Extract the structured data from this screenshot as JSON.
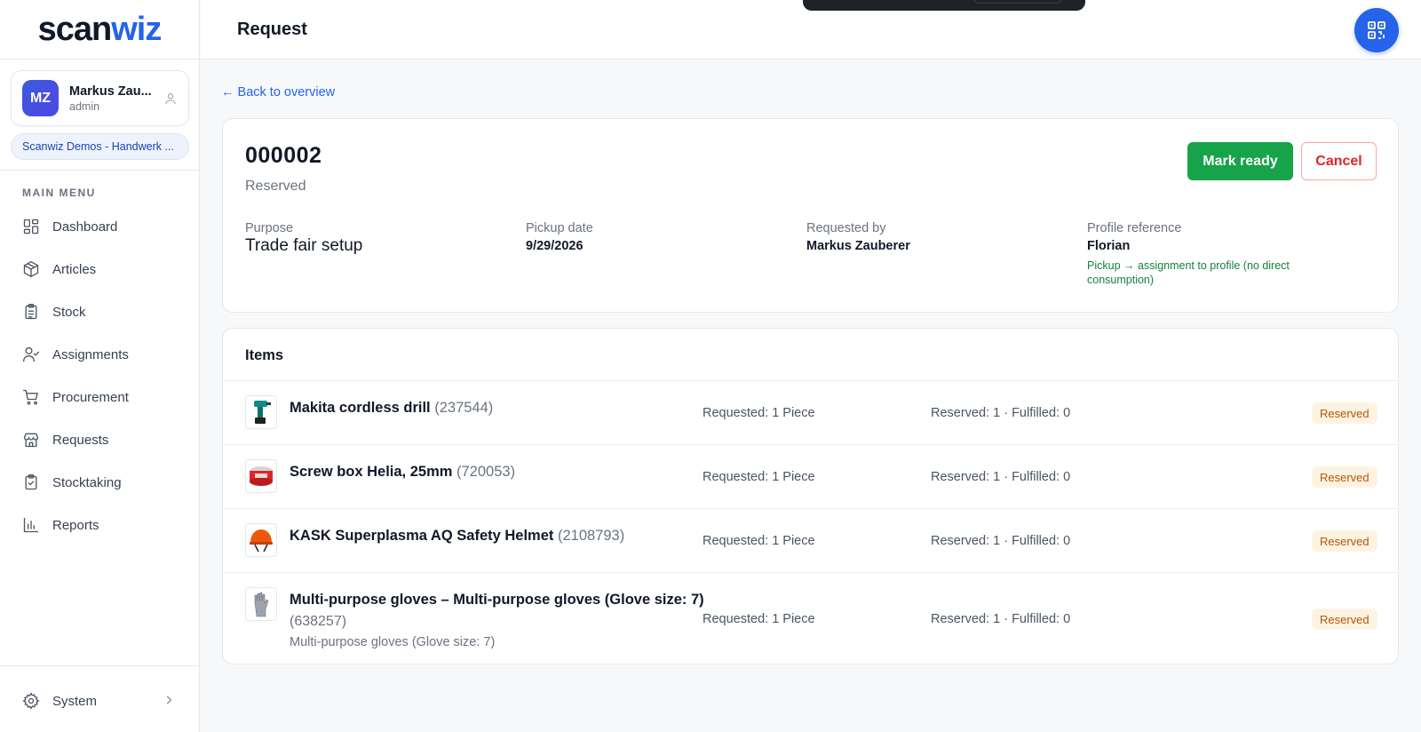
{
  "app": {
    "logo_part1": "scan",
    "logo_part2": "wiz"
  },
  "user": {
    "initials": "MZ",
    "name": "Markus Zau...",
    "role": "admin"
  },
  "tenant": "Scanwiz Demos - Handwerk ...",
  "menu": {
    "heading": "MAIN MENU",
    "items": [
      {
        "label": "Dashboard",
        "icon": "dashboard-icon"
      },
      {
        "label": "Articles",
        "icon": "cube-icon"
      },
      {
        "label": "Stock",
        "icon": "clipboard-list-icon"
      },
      {
        "label": "Assignments",
        "icon": "user-check-icon"
      },
      {
        "label": "Procurement",
        "icon": "cart-icon"
      },
      {
        "label": "Requests",
        "icon": "store-icon"
      },
      {
        "label": "Stocktaking",
        "icon": "clipboard-check-icon"
      },
      {
        "label": "Reports",
        "icon": "bar-chart-icon"
      }
    ],
    "system": {
      "label": "System",
      "icon": "gear-icon"
    }
  },
  "header": {
    "title": "Request"
  },
  "back_link": "← Back to overview",
  "request": {
    "number": "000002",
    "status": "Reserved",
    "actions": {
      "ready": "Mark ready",
      "cancel": "Cancel"
    },
    "fields": {
      "purpose": {
        "label": "Purpose",
        "value": "Trade fair setup"
      },
      "pickup": {
        "label": "Pickup date",
        "value": "9/29/2026"
      },
      "requested_by": {
        "label": "Requested by",
        "value": "Markus Zauberer"
      },
      "profile": {
        "label": "Profile reference",
        "value": "Florian",
        "note": "Pickup → assignment to profile (no direct consumption)"
      }
    }
  },
  "items": {
    "title": "Items",
    "rows": [
      {
        "name": "Makita cordless drill",
        "sku": "(237544)",
        "requested": "Requested: 1 Piece",
        "reserved": "Reserved: 1 · Fulfilled: 0",
        "badge": "Reserved",
        "thumb": "drill-icon"
      },
      {
        "name": "Screw box Helia, 25mm",
        "sku": "(720053)",
        "requested": "Requested: 1 Piece",
        "reserved": "Reserved: 1 · Fulfilled: 0",
        "badge": "Reserved",
        "thumb": "screw-box-icon"
      },
      {
        "name": "KASK Superplasma AQ Safety Helmet",
        "sku": "(2108793)",
        "requested": "Requested: 1 Piece",
        "reserved": "Reserved: 1 · Fulfilled: 0",
        "badge": "Reserved",
        "thumb": "helmet-icon"
      },
      {
        "name": "Multi-purpose gloves – Multi-purpose gloves (Glove size: 7)",
        "sku": "(638257)",
        "subtitle": "Multi-purpose gloves (Glove size: 7)",
        "requested": "Requested: 1 Piece",
        "reserved": "Reserved: 1 · Fulfilled: 0",
        "badge": "Reserved",
        "thumb": "glove-icon"
      }
    ]
  }
}
